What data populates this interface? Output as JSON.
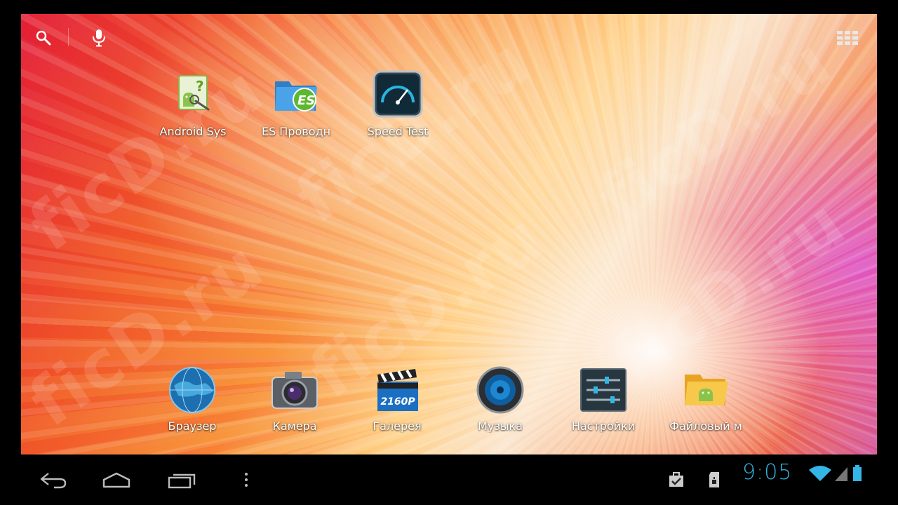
{
  "home": {
    "top_icons": [
      {
        "label": "Android Sys",
        "icon": "android-system-icon"
      },
      {
        "label": "ES Проводн",
        "icon": "es-file-explorer-icon"
      },
      {
        "label": "Speed Test",
        "icon": "speedtest-gauge-icon"
      }
    ],
    "dock": [
      {
        "label": "Браузер",
        "icon": "globe-icon"
      },
      {
        "label": "Камера",
        "icon": "camera-icon"
      },
      {
        "label": "Галерея",
        "icon": "clapperboard-icon",
        "badge": "2160P"
      },
      {
        "label": "Музыка",
        "icon": "speaker-icon"
      },
      {
        "label": "Настройки",
        "icon": "settings-sliders-icon"
      },
      {
        "label": "Файловый м",
        "icon": "file-manager-folder-icon"
      }
    ]
  },
  "watermark": "ficD.ru",
  "status": {
    "time": "9:05",
    "accent": "#33b5e5"
  }
}
